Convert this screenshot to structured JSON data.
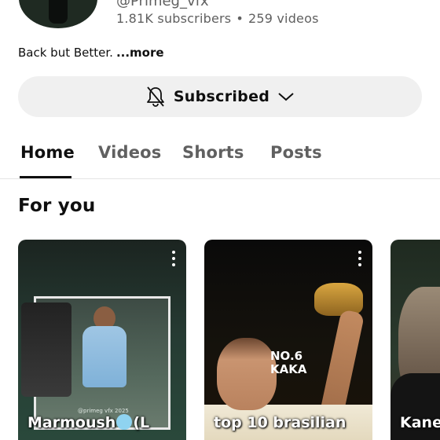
{
  "channel": {
    "handle": "@Primeg_vfx",
    "subscribers": "1.81K subscribers",
    "separator": "•",
    "videos": "259 videos",
    "description": "Back but Better.",
    "more_label": "...more"
  },
  "subscribe": {
    "label": "Subscribed",
    "bell_icon": "bell-off-icon",
    "chevron_icon": "chevron-down-icon"
  },
  "tabs": [
    {
      "label": "Home",
      "active": true
    },
    {
      "label": "Videos",
      "active": false
    },
    {
      "label": "Shorts",
      "active": false
    },
    {
      "label": "Posts",
      "active": false
    }
  ],
  "section": {
    "title": "For you"
  },
  "shorts": [
    {
      "title_start": "Marmoush",
      "title_end": "(L",
      "watermark": "@primeg vfx 2025",
      "badge_icon": "cold-face-emoji-icon"
    },
    {
      "title": "top 10 brasilian",
      "overlay_line1": "NO.6",
      "overlay_line2": "KAKA"
    },
    {
      "title": "Kane"
    }
  ],
  "colors": {
    "text_primary": "#0f0f0f",
    "text_secondary": "#606060",
    "button_bg": "#f0f0f0",
    "divider": "#e5e5e5"
  }
}
